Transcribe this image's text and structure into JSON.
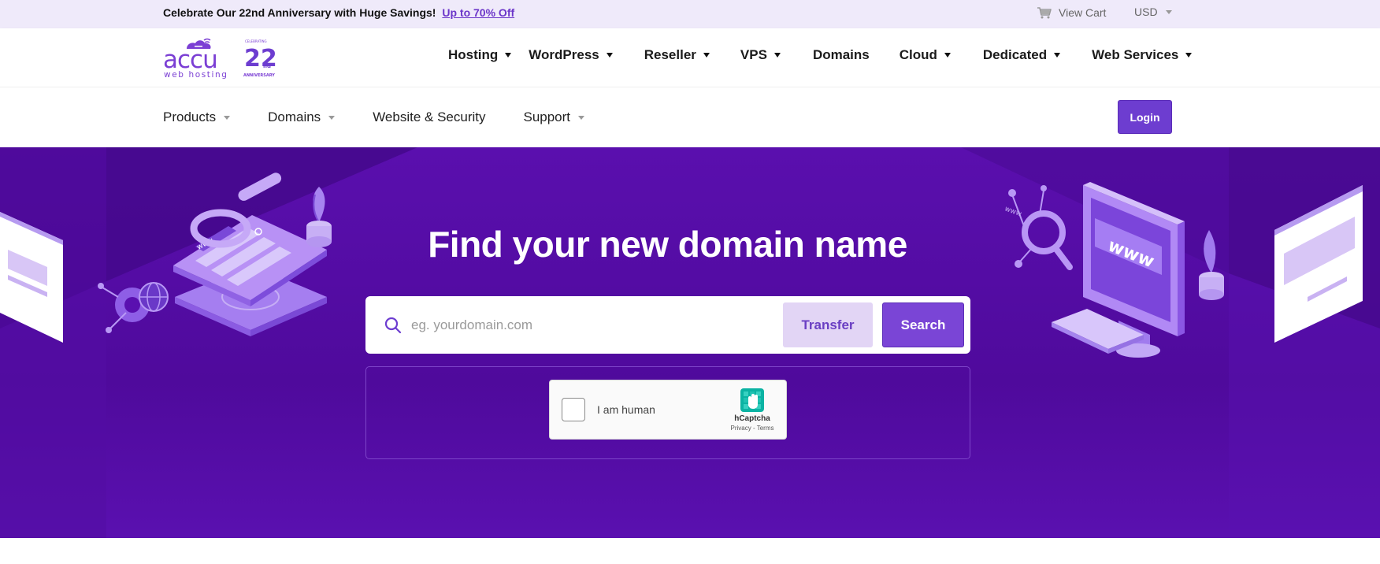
{
  "promo": {
    "text": "Celebrate Our 22nd Anniversary with Huge Savings!",
    "link": "Up to 70% Off"
  },
  "topbar": {
    "view_cart": "View Cart",
    "currency": "USD"
  },
  "logo": {
    "wordmark": "accu",
    "tagline": "web hosting",
    "badge_number": "22",
    "badge_suffix": "nd",
    "badge_top": "CELEBRATING",
    "badge_bottom": "ANNIVERSARY"
  },
  "nav": {
    "items": [
      {
        "label": "Hosting",
        "dropdown": true
      },
      {
        "label": "WordPress",
        "dropdown": true
      },
      {
        "label": "Reseller",
        "dropdown": true
      },
      {
        "label": "VPS",
        "dropdown": true
      },
      {
        "label": "Domains",
        "dropdown": false
      },
      {
        "label": "Cloud",
        "dropdown": true
      },
      {
        "label": "Dedicated",
        "dropdown": true
      },
      {
        "label": "Web Services",
        "dropdown": true
      }
    ]
  },
  "subnav": {
    "items": [
      {
        "label": "Products",
        "dropdown": true
      },
      {
        "label": "Domains",
        "dropdown": true
      },
      {
        "label": "Website & Security",
        "dropdown": false
      },
      {
        "label": "Support",
        "dropdown": true
      }
    ],
    "login": "Login"
  },
  "hero": {
    "title": "Find your new domain name",
    "search_placeholder": "eg. yourdomain.com",
    "transfer_label": "Transfer",
    "search_label": "Search",
    "illustration_text": "www"
  },
  "captcha": {
    "label": "I am human",
    "brand": "hCaptcha",
    "privacy": "Privacy",
    "separator": " - ",
    "terms": "Terms"
  },
  "colors": {
    "brand_purple": "#6d3dd0",
    "hero_bg": "#5a0fae",
    "promo_bg": "#efeafa",
    "transfer_bg": "#e2d5f5"
  }
}
